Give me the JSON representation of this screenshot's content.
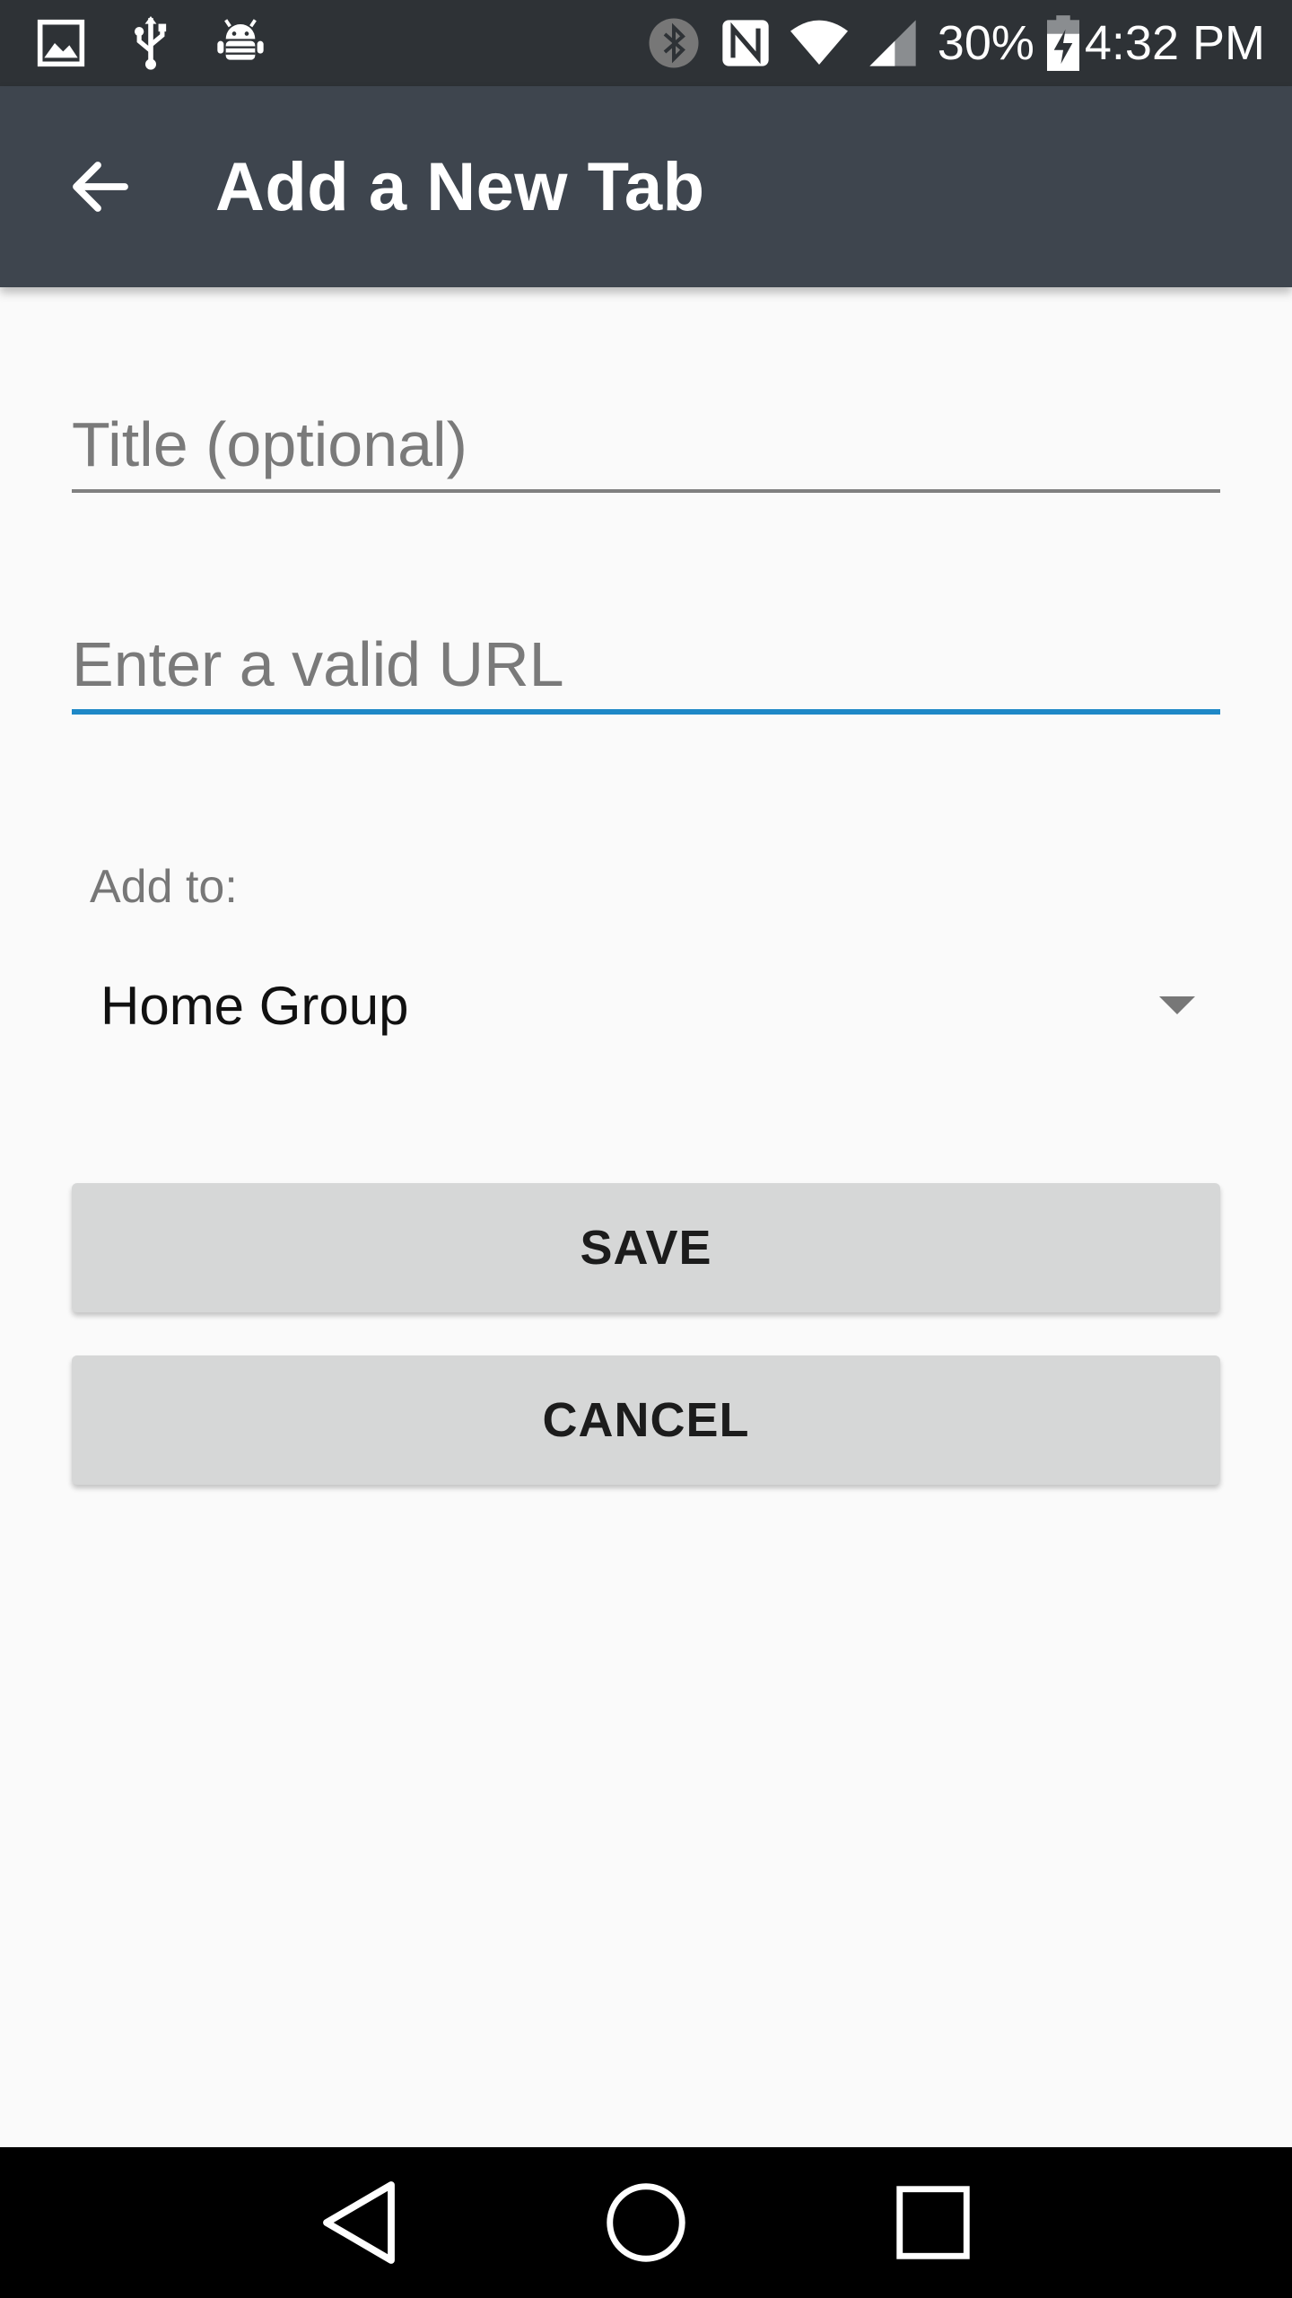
{
  "status_bar": {
    "battery_percent": "30%",
    "time": "4:32 PM",
    "icons_left": [
      "image-icon",
      "usb-icon",
      "android-debug-icon"
    ],
    "icons_right": [
      "bluetooth-icon",
      "nfc-icon",
      "wifi-icon",
      "cell-signal-icon",
      "battery-charging-icon"
    ]
  },
  "app_bar": {
    "title": "Add a New Tab",
    "back_icon": "arrow-back-icon",
    "background": "#3e454e"
  },
  "form": {
    "title_field": {
      "value": "",
      "placeholder": "Title (optional)"
    },
    "url_field": {
      "value": "",
      "placeholder": "Enter a valid URL",
      "focused": true,
      "accent": "#1e88c7"
    },
    "add_to_label": "Add to:",
    "group_spinner": {
      "selected": "Home Group"
    }
  },
  "buttons": {
    "save_label": "SAVE",
    "cancel_label": "CANCEL"
  },
  "nav_bar": {
    "icons": [
      "nav-back-icon",
      "nav-home-icon",
      "nav-recents-icon"
    ]
  }
}
